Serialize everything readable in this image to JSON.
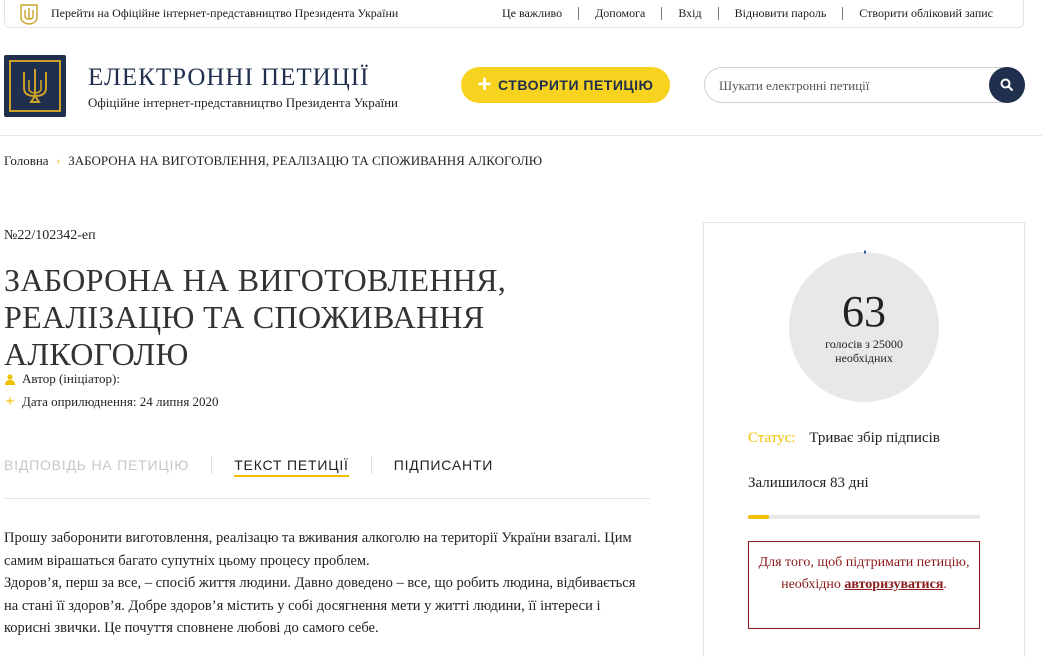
{
  "topbar": {
    "gov_link": "Перейти на Офіційне інтернет-представництво Президента України",
    "links": [
      "Це важливо",
      "Допомога",
      "Вхід",
      "Відновити пароль",
      "Створити обліковий запис"
    ]
  },
  "header": {
    "title": "ЕЛЕКТРОННІ ПЕТИЦІЇ",
    "subtitle": "Офіційне інтернет-представництво Президента України",
    "create_button": "СТВОРИТИ ПЕТИЦІЮ",
    "search_placeholder": "Шукати електронні петиції"
  },
  "breadcrumb": {
    "home": "Головна",
    "current": "ЗАБОРОНА НА ВИГОТОВЛЕННЯ, РЕАЛІЗАЦЮ ТА СПОЖИВАННЯ АЛКОГОЛЮ"
  },
  "petition": {
    "number": "№22/102342-еп",
    "title": "ЗАБОРОНА НА ВИГОТОВЛЕННЯ, РЕАЛІЗАЦЮ ТА СПОЖИВАННЯ АЛКОГОЛЮ",
    "author_label": "Автор (ініціатор):",
    "date_label": "Дата оприлюднення: 24 липня 2020",
    "tabs": [
      "ВІДПОВІДЬ НА ПЕТИЦІЮ",
      "ТЕКСТ ПЕТИЦІЇ",
      "ПІДПИСАНТИ"
    ],
    "text": [
      "Прошу заборонити виготовлення, реалізацю та вживания алкоголю на території України взагалі. Цим самим вірашаться багато супутніх цьому процесу проблем.",
      "Здоров’я, перш за все, – спосіб життя людини. Давно доведено – все, що робить людина, відбивається на стані її здоров’я. Добре здоров’я містить у собі досягнення мети у житті людини, її інтереси і корисні звички. Це почуття сповнене любові до самого себе."
    ]
  },
  "sidebar": {
    "votes": "63",
    "votes_sub1": "голосів з 25000",
    "votes_sub2": "необхідних",
    "votes_fraction": 0.00252,
    "status_label": "Статус:",
    "status_value": "Триває збір підписів",
    "remaining": "Залишилося 83 дні",
    "time_progress": 0.09,
    "auth_text1": "Для того, щоб підтримати петицію, необхідно",
    "auth_link": "авторизуватися",
    "auth_end": "."
  },
  "colors": {
    "navy": "#1f2f4d",
    "yellow": "#f7d21e",
    "accent": "#f0c000",
    "danger": "#8b1a1a"
  }
}
